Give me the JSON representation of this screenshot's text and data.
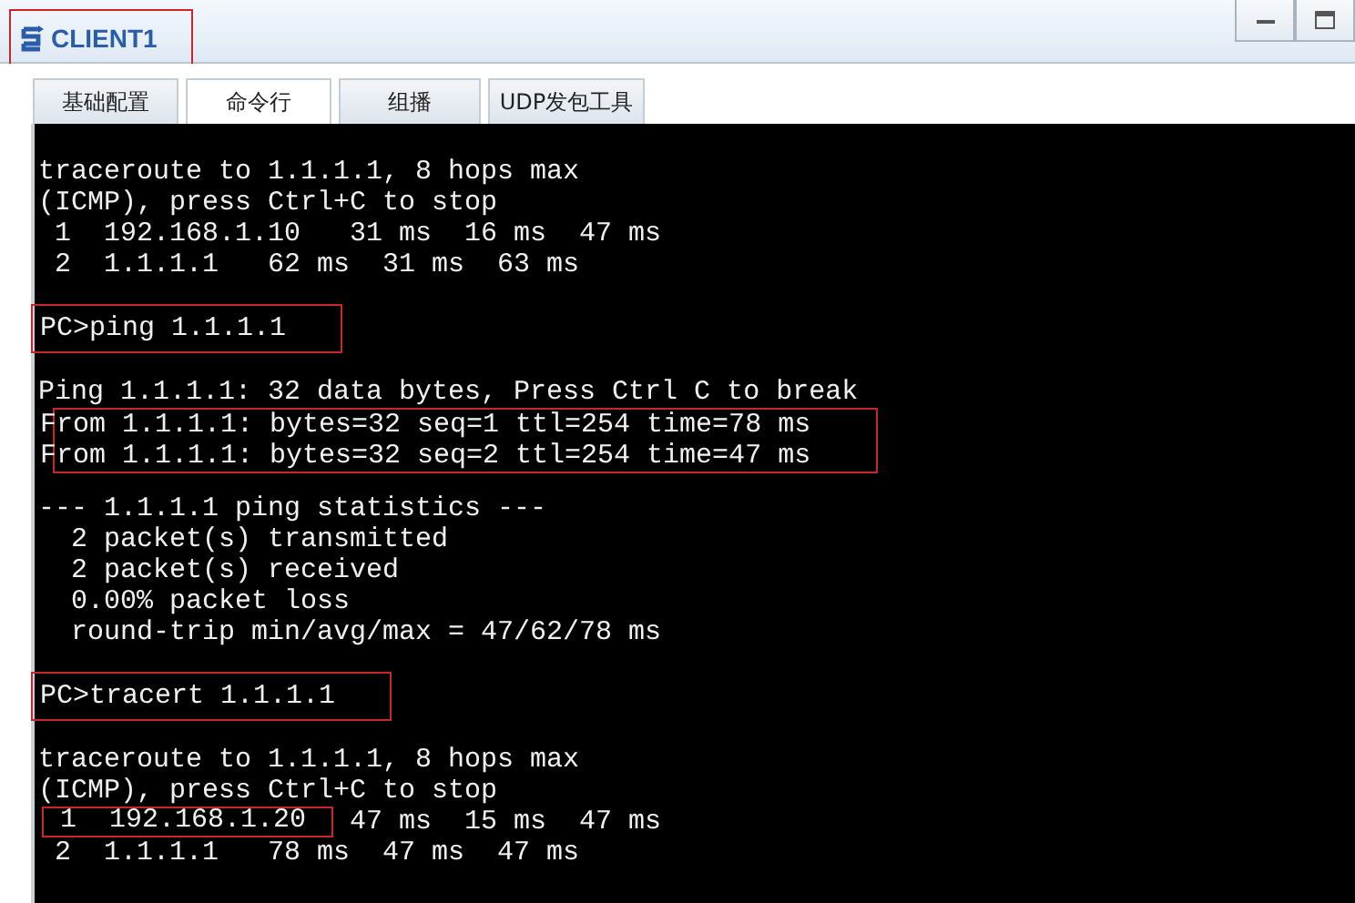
{
  "window": {
    "title": "CLIENT1",
    "title_marked": true
  },
  "tabs": [
    {
      "label": "基础配置",
      "selected": false
    },
    {
      "label": "命令行",
      "selected": true
    },
    {
      "label": "组播",
      "selected": false
    },
    {
      "label": "UDP发包工具",
      "selected": false
    }
  ],
  "terminal": {
    "blocks": [
      {
        "kind": "plain",
        "lines": [
          "traceroute to 1.1.1.1, 8 hops max",
          "(ICMP), press Ctrl+C to stop",
          " 1  192.168.1.10   31 ms  16 ms  47 ms",
          " 2  1.1.1.1   62 ms  31 ms  63 ms"
        ]
      },
      {
        "kind": "boxed",
        "spaced": true,
        "lines": [
          "PC>ping 1.1.1.1"
        ]
      },
      {
        "kind": "plain",
        "spaced": true,
        "lines": [
          "Ping 1.1.1.1: 32 data bytes, Press Ctrl C to break"
        ]
      },
      {
        "kind": "boxed",
        "lines": [
          "From 1.1.1.1: bytes=32 seq=1 ttl=254 time=78 ms",
          "From 1.1.1.1: bytes=32 seq=2 ttl=254 time=47 ms"
        ]
      },
      {
        "kind": "plain",
        "spaced": true,
        "lines": [
          "--- 1.1.1.1 ping statistics ---",
          "  2 packet(s) transmitted",
          "  2 packet(s) received",
          "  0.00% packet loss",
          "  round-trip min/avg/max = 47/62/78 ms"
        ]
      },
      {
        "kind": "boxed",
        "spaced": true,
        "lines": [
          "PC>tracert 1.1.1.1"
        ]
      },
      {
        "kind": "plain",
        "spaced": true,
        "lines": [
          "traceroute to 1.1.1.1, 8 hops max",
          "(ICMP), press Ctrl+C to stop"
        ]
      },
      {
        "kind": "inline",
        "marked": " 1  192.168.1.20",
        "rest": "47 ms  15 ms  47 ms"
      },
      {
        "kind": "plain",
        "lines": [
          " 2  1.1.1.1   78 ms  47 ms  47 ms"
        ]
      }
    ]
  }
}
